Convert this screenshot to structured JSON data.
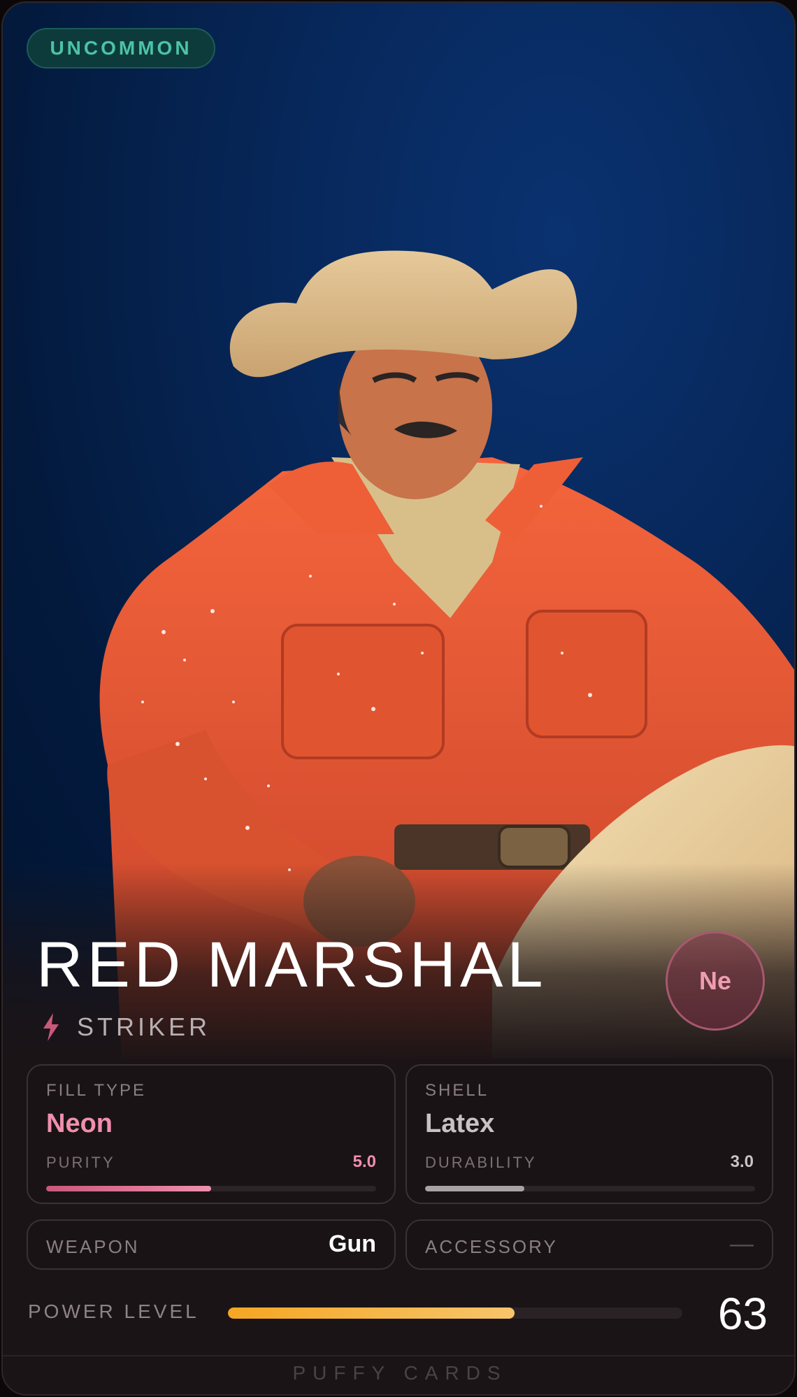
{
  "card": {
    "rarity": "UNCOMMON",
    "name": "RED MARSHAL",
    "class_icon": "lightning-bolt-icon",
    "class": "STRIKER",
    "element": "Ne",
    "fill_type": {
      "label": "FILL TYPE",
      "value": "Neon",
      "stat_label": "PURITY",
      "stat_value": "5.0",
      "stat_fraction": 0.5,
      "color": "#f08fae"
    },
    "shell": {
      "label": "SHELL",
      "value": "Latex",
      "stat_label": "DURABILITY",
      "stat_value": "3.0",
      "stat_fraction": 0.3,
      "color": "#c9c2c5"
    },
    "weapon": {
      "label": "WEAPON",
      "value": "Gun"
    },
    "accessory": {
      "label": "ACCESSORY",
      "value": "—"
    },
    "power": {
      "label": "POWER LEVEL",
      "value": "63",
      "fraction": 0.63
    },
    "footer": "PUFFY CARDS"
  },
  "colors": {
    "rarity_text": "#4cc3a6",
    "power_bar": "#f5a623",
    "element_text": "#ee9db2"
  }
}
